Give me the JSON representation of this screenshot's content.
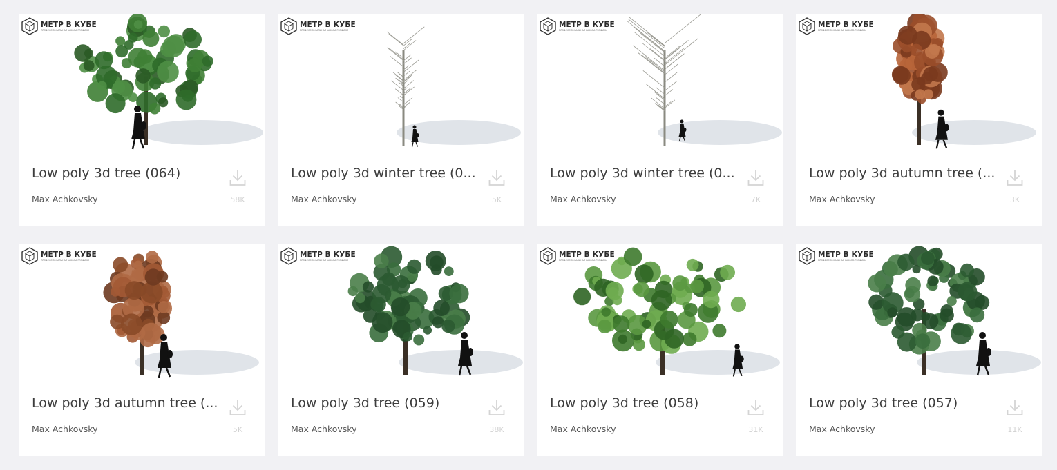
{
  "logo": {
    "title": "МЕТР В КУБЕ",
    "subtitle": "ПРОФЕССИОНАЛЬНАЯ ШКОЛА ГРАФИКИ"
  },
  "icons": {
    "download": "download-icon",
    "logo": "cube-logo-icon"
  },
  "colors": {
    "background": "#f1f1f4",
    "card": "#ffffff",
    "title": "#3d3d3d",
    "author": "#555555",
    "muted": "#d2d2d2"
  },
  "cards": [
    {
      "title": "Low poly 3d tree (064)",
      "author": "Max Achkovsky",
      "downloads": "58K",
      "foliage": "green"
    },
    {
      "title": "Low poly 3d winter tree (0...",
      "author": "Max Achkovsky",
      "downloads": "5K",
      "foliage": "bare-slim"
    },
    {
      "title": "Low poly 3d winter tree (0...",
      "author": "Max Achkovsky",
      "downloads": "7K",
      "foliage": "bare-wide"
    },
    {
      "title": "Low poly 3d autumn tree (...",
      "author": "Max Achkovsky",
      "downloads": "3K",
      "foliage": "autumn-slim"
    },
    {
      "title": "Low poly 3d autumn tree (...",
      "author": "Max Achkovsky",
      "downloads": "5K",
      "foliage": "autumn"
    },
    {
      "title": "Low poly 3d tree (059)",
      "author": "Max Achkovsky",
      "downloads": "38K",
      "foliage": "green-dark"
    },
    {
      "title": "Low poly 3d tree (058)",
      "author": "Max Achkovsky",
      "downloads": "31K",
      "foliage": "green-wide"
    },
    {
      "title": "Low poly 3d tree (057)",
      "author": "Max Achkovsky",
      "downloads": "11K",
      "foliage": "green-dark"
    }
  ]
}
